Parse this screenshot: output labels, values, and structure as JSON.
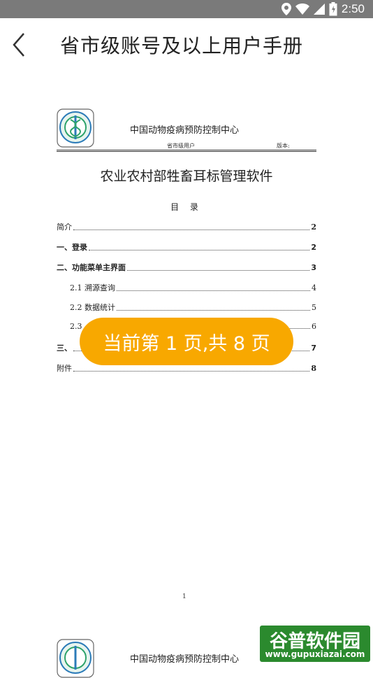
{
  "status_bar": {
    "time": "2:50"
  },
  "app_bar": {
    "title": "省市级账号及以上用户手册"
  },
  "document": {
    "org_name": "中国动物疫病预防控制中心",
    "header_left": "省市级用户",
    "header_right": "版本:",
    "title": "农业农村部牲畜耳标管理软件",
    "toc_title": "目 录",
    "toc": [
      {
        "label": "简介",
        "page": "2"
      },
      {
        "label": "一、登录",
        "page": "2"
      },
      {
        "label": "二、功能菜单主界面",
        "page": "3"
      },
      {
        "label": "2.1 溯源查询",
        "page": "4"
      },
      {
        "label": "2.2 数据统计",
        "page": "5"
      },
      {
        "label": "2.3",
        "page": "6"
      },
      {
        "label": "三、",
        "page": "7"
      },
      {
        "label": "附件",
        "page": "8"
      }
    ],
    "page_number": "1",
    "next_page_org_name": "中国动物疫病预防控制中心"
  },
  "toast": {
    "text": "当前第 1 页,共 8 页"
  },
  "watermark": {
    "line1": "谷普软件园",
    "line2": "www.gupuxiazai.com"
  }
}
